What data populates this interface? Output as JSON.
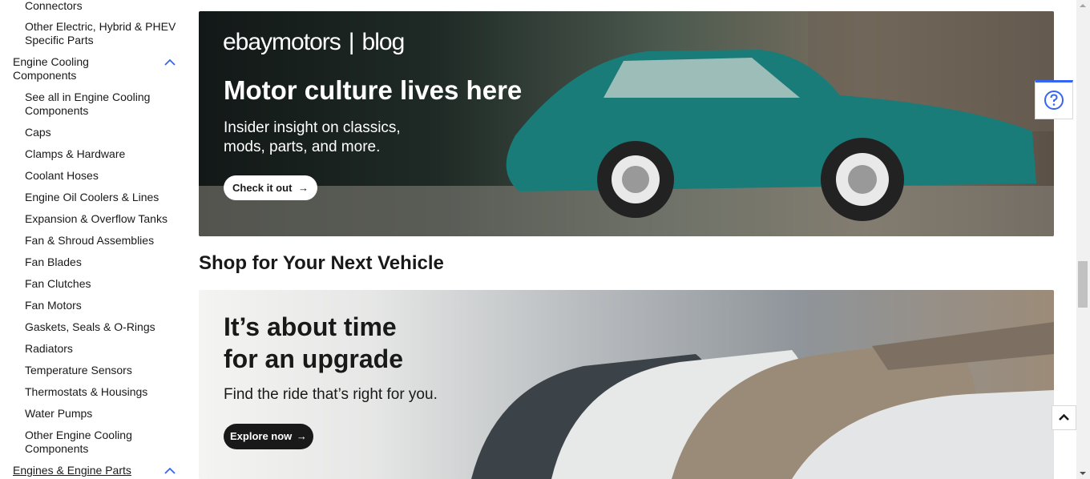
{
  "sidebar": {
    "top_items": [
      "Connectors",
      "Other Electric, Hybrid & PHEV Specific Parts"
    ],
    "engine_cooling": {
      "heading": "Engine Cooling Components",
      "items": [
        "See all in Engine Cooling Components",
        "Caps",
        "Clamps & Hardware",
        "Coolant Hoses",
        "Engine Oil Coolers & Lines",
        "Expansion & Overflow Tanks",
        "Fan & Shroud Assemblies",
        "Fan Blades",
        "Fan Clutches",
        "Fan Motors",
        "Gaskets, Seals & O-Rings",
        "Radiators",
        "Temperature Sensors",
        "Thermostats & Housings",
        "Water Pumps",
        "Other Engine Cooling Components"
      ]
    },
    "engines_heading": "Engines & Engine Parts"
  },
  "blog_banner": {
    "brand": "ebaymotors",
    "brand_suffix": "blog",
    "headline": "Motor culture lives here",
    "subtext_line1": "Insider insight on classics,",
    "subtext_line2": "mods, parts, and more.",
    "cta": "Check it out"
  },
  "section_title": "Shop for Your Next Vehicle",
  "vehicle_banner": {
    "headline_line1": "It’s about time",
    "headline_line2": "for an upgrade",
    "subtext": "Find the ride that’s right for you.",
    "cta": "Explore now"
  },
  "colors": {
    "accent": "#3665f3",
    "car_teal": "#1a7c78"
  },
  "icons": {
    "help": "help-circle-icon",
    "back_to_top": "chevron-up-icon",
    "collapse": "chevron-up-icon",
    "arrow": "arrow-right-icon"
  }
}
